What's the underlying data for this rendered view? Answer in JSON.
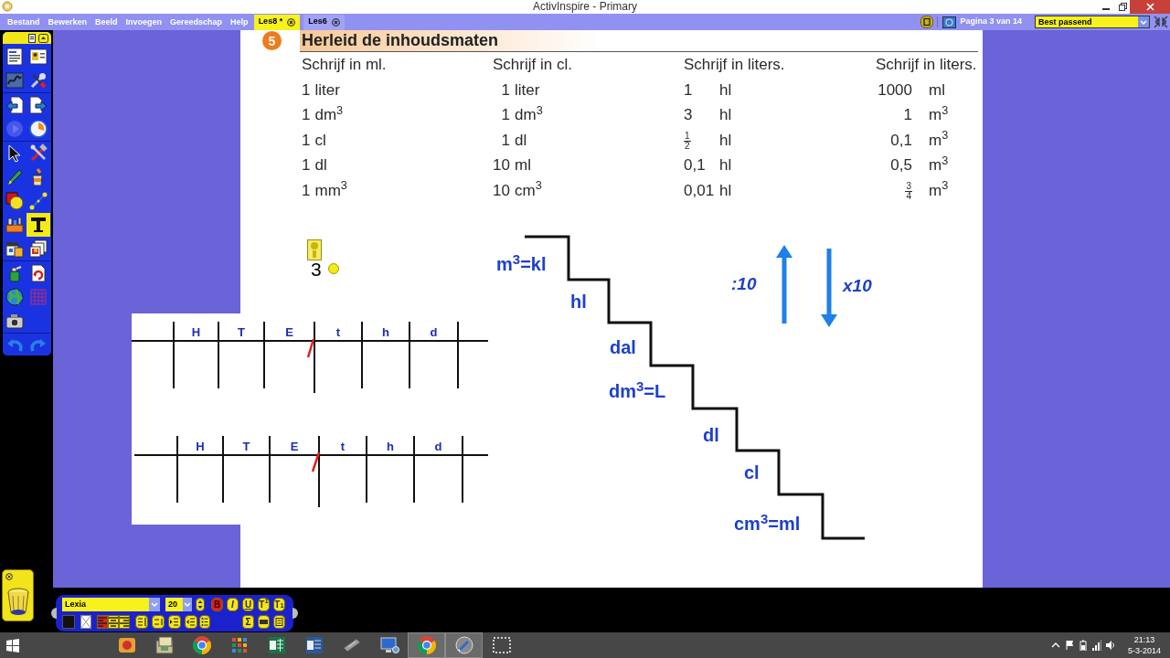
{
  "window": {
    "title": "ActivInspire - Primary"
  },
  "menu": [
    "Bestand",
    "Bewerken",
    "Beeld",
    "Invoegen",
    "Gereedschap",
    "Help"
  ],
  "tabs": [
    {
      "label": "Les8 *",
      "selected": true
    },
    {
      "label": "Les6",
      "selected": false
    }
  ],
  "page_indicator": "Pagina 3 van 14",
  "zoom_select": {
    "value": "Best passend"
  },
  "main_toolbox": {
    "tools": [
      {
        "selected": false,
        "disabled": false
      },
      {
        "selected": false,
        "disabled": false
      },
      {
        "selected": false,
        "disabled": false
      },
      {
        "selected": false,
        "disabled": false
      },
      {
        "selected": false,
        "disabled": false
      },
      {
        "selected": false,
        "disabled": false
      },
      {
        "selected": false,
        "disabled": true
      },
      {
        "selected": false,
        "disabled": false
      },
      {
        "selected": false,
        "disabled": false
      },
      {
        "selected": false,
        "disabled": false
      },
      {
        "selected": false,
        "disabled": false
      },
      {
        "selected": false,
        "disabled": false
      },
      {
        "selected": false,
        "disabled": false
      },
      {
        "selected": false,
        "disabled": false
      },
      {
        "selected": false,
        "disabled": false
      },
      {
        "selected": true,
        "disabled": false
      },
      {
        "selected": false,
        "disabled": false
      },
      {
        "selected": false,
        "disabled": false
      },
      {
        "selected": false,
        "disabled": false
      },
      {
        "selected": false,
        "disabled": false
      },
      {
        "selected": false,
        "disabled": false
      },
      {
        "selected": false,
        "disabled": false
      },
      {
        "selected": false,
        "disabled": false
      },
      {
        "selected": false,
        "disabled": false
      },
      {
        "selected": false,
        "disabled": false
      }
    ]
  },
  "flipchart": {
    "exercise": {
      "number": "5",
      "title": "Herleid de inhoudsmaten",
      "columns": [
        {
          "heading": "Schrijf in ml.",
          "cells": [
            {
              "kind": "number",
              "value": "1",
              "unit": "liter"
            },
            {
              "kind": "number",
              "value": "1",
              "unit": "dm$^{3}$"
            },
            {
              "kind": "number",
              "value": "1",
              "unit": "cl"
            },
            {
              "kind": "number",
              "value": "1",
              "unit": "dl"
            },
            {
              "kind": "number",
              "value": "1",
              "unit": "mm$^{3}$"
            }
          ]
        },
        {
          "heading": "Schrijf in cl.",
          "cells": [
            {
              "kind": "number",
              "value": "1",
              "unit": "liter"
            },
            {
              "kind": "number",
              "value": "1",
              "unit": "dm$^{3}$"
            },
            {
              "kind": "number",
              "value": "1",
              "unit": "dl"
            },
            {
              "kind": "number",
              "value": "10",
              "unit": "ml"
            },
            {
              "kind": "number",
              "value": "10",
              "unit": "cm$^{3}$"
            }
          ]
        },
        {
          "heading": "Schrijf in liters.",
          "cells": [
            {
              "kind": "number",
              "value": "1",
              "unit": "hl"
            },
            {
              "kind": "number",
              "value": "3",
              "unit": "hl"
            },
            {
              "kind": "fraction",
              "numerator": "1",
              "denominator": "2",
              "unit": "hl"
            },
            {
              "kind": "number",
              "value": "0,1",
              "unit": "hl"
            },
            {
              "kind": "number",
              "value": "0,01",
              "unit": "hl"
            }
          ]
        },
        {
          "heading": "Schrijf in liters.",
          "cells": [
            {
              "kind": "number",
              "value": "1000",
              "unit": "ml"
            },
            {
              "kind": "number",
              "value": "1",
              "unit": "m$^{3}$"
            },
            {
              "kind": "number",
              "value": "0,1",
              "unit": "m$^{3}$"
            },
            {
              "kind": "number",
              "value": "0,5",
              "unit": "m$^{3}$"
            },
            {
              "kind": "fraction",
              "numerator": "3",
              "denominator": "4",
              "unit": "m$^{3}$"
            }
          ]
        }
      ]
    },
    "text_object": {
      "text": "3"
    },
    "place_value_charts": [
      {
        "labels": [
          "H",
          "T",
          "E",
          "t",
          "h",
          "d"
        ]
      },
      {
        "labels": [
          "H",
          "T",
          "E",
          "t",
          "h",
          "d"
        ]
      }
    ],
    "staircase": {
      "labels": [
        "m$^{3}$=kl",
        "hl",
        "dal",
        "dm$^{3}$=L",
        "dl",
        "cl",
        "cm$^{3}$=ml"
      ]
    },
    "arrows": [
      {
        "kind": "up",
        "label": ":10"
      },
      {
        "kind": "down",
        "label": "x10"
      }
    ]
  },
  "text_toolbar": {
    "font": "Lexia",
    "size": "20",
    "styles": [
      {
        "label": "B",
        "on": true
      },
      {
        "label": "I",
        "on": false
      },
      {
        "label": "U",
        "on": false
      },
      {
        "label": "T$^{1}$",
        "on": false
      },
      {
        "label": "T$_{1}$",
        "on": false
      }
    ],
    "alignment": [
      {
        "selected": true
      },
      {
        "selected": false
      },
      {
        "selected": false
      }
    ],
    "symbol_button": "Σ"
  },
  "taskbar": {
    "apps": [
      {
        "selected": false
      },
      {
        "selected": false
      },
      {
        "selected": false
      },
      {
        "selected": false
      },
      {
        "selected": false
      },
      {
        "selected": false
      },
      {
        "selected": false
      },
      {
        "selected": false
      },
      {
        "selected": true
      },
      {
        "selected": true
      },
      {
        "selected": false
      }
    ],
    "time": "21:13",
    "date": "5-3-2014"
  }
}
